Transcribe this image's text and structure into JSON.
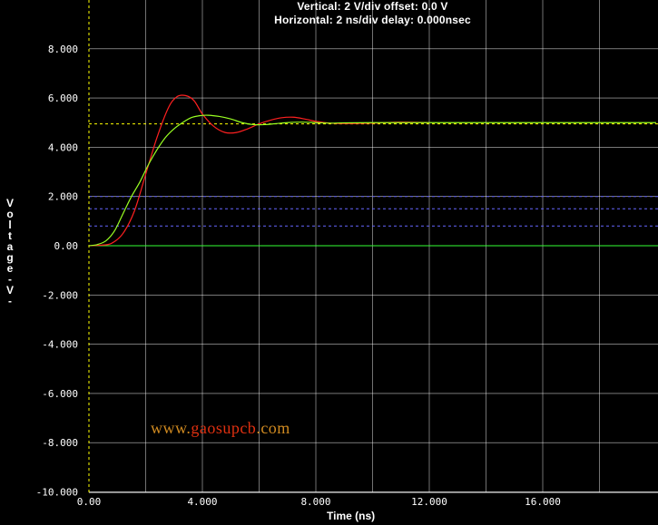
{
  "header": {
    "vertical": "Vertical: 2  V/div  offset: 0.0 V",
    "horizontal": "Horizontal: 2 ns/div  delay: 0.000nsec"
  },
  "watermark": {
    "part1": "www.",
    "part2": "gaosupcb",
    "part3": ".com"
  },
  "colors": {
    "background": "#000000",
    "grid": "#ffffff",
    "red_trace": "#ff2020",
    "green_trace": "#99ff22",
    "threshold_yellow": "#ffff00",
    "threshold_blue": "#6666ff",
    "zero_green": "#33ff33"
  },
  "chart_data": {
    "type": "line",
    "title": "",
    "xlabel": "Time  (ns)",
    "ylabel": "Voltage -V-",
    "xlim": [
      0,
      20
    ],
    "ylim": [
      -10,
      10
    ],
    "x_ticks": [
      0,
      2,
      4,
      6,
      8,
      10,
      12,
      14,
      16,
      18
    ],
    "x_tick_labels": [
      "0.00",
      "",
      "4.000",
      "",
      "8.000",
      "",
      "12.000",
      "",
      "16.000",
      ""
    ],
    "y_ticks": [
      8,
      6,
      4,
      2,
      0,
      -2,
      -4,
      -6,
      -8,
      -10
    ],
    "y_tick_labels": [
      "8.000",
      "6.000",
      "4.000",
      "2.000",
      "0.00",
      "-2.000",
      "-4.000",
      "-6.000",
      "-8.000",
      "-10.000"
    ],
    "grid": true,
    "series": [
      {
        "color": "#ff2020",
        "x": [
          0,
          0.4,
          0.8,
          1.2,
          1.6,
          2.0,
          2.4,
          2.8,
          3.1,
          3.4,
          3.7,
          4.0,
          4.4,
          4.8,
          5.2,
          5.6,
          6.0,
          6.4,
          6.8,
          7.2,
          7.6,
          8.0,
          8.5,
          9.0,
          10.0,
          11.0,
          12.0
        ],
        "y": [
          0,
          0.02,
          0.1,
          0.5,
          1.4,
          2.9,
          4.4,
          5.6,
          6.05,
          6.1,
          5.9,
          5.35,
          4.85,
          4.6,
          4.6,
          4.75,
          4.95,
          5.1,
          5.2,
          5.22,
          5.15,
          5.05,
          4.98,
          4.96,
          4.98,
          5.02,
          5.0
        ]
      },
      {
        "color": "#99ff22",
        "x": [
          0,
          0.3,
          0.6,
          0.9,
          1.2,
          1.5,
          1.8,
          2.1,
          2.4,
          2.7,
          3.0,
          3.3,
          3.6,
          3.9,
          4.2,
          4.6,
          5.0,
          5.4,
          5.8,
          6.2,
          6.6,
          7.0,
          7.5,
          8.0,
          8.5,
          9.0,
          10.0,
          12.0,
          16.0,
          20.0
        ],
        "y": [
          0,
          0.05,
          0.2,
          0.6,
          1.3,
          2.0,
          2.6,
          3.3,
          3.9,
          4.4,
          4.75,
          5.0,
          5.2,
          5.28,
          5.3,
          5.25,
          5.15,
          5.0,
          4.92,
          4.92,
          4.96,
          5.0,
          5.02,
          5.0,
          4.98,
          4.99,
          5.0,
          5.0,
          5.0,
          5.0
        ]
      }
    ],
    "reference_lines": [
      {
        "y": 4.95,
        "color": "#ffff00",
        "style": "dashed"
      },
      {
        "y": 2.0,
        "color": "#6666ff",
        "style": "dashed"
      },
      {
        "y": 1.5,
        "color": "#6666ff",
        "style": "dashed"
      },
      {
        "y": 0.8,
        "color": "#6666ff",
        "style": "dashed"
      },
      {
        "y": 0,
        "color": "#33ff33",
        "style": "solid"
      },
      {
        "x": 0,
        "color": "#ffff00",
        "style": "dashed",
        "orientation": "vertical"
      }
    ]
  }
}
